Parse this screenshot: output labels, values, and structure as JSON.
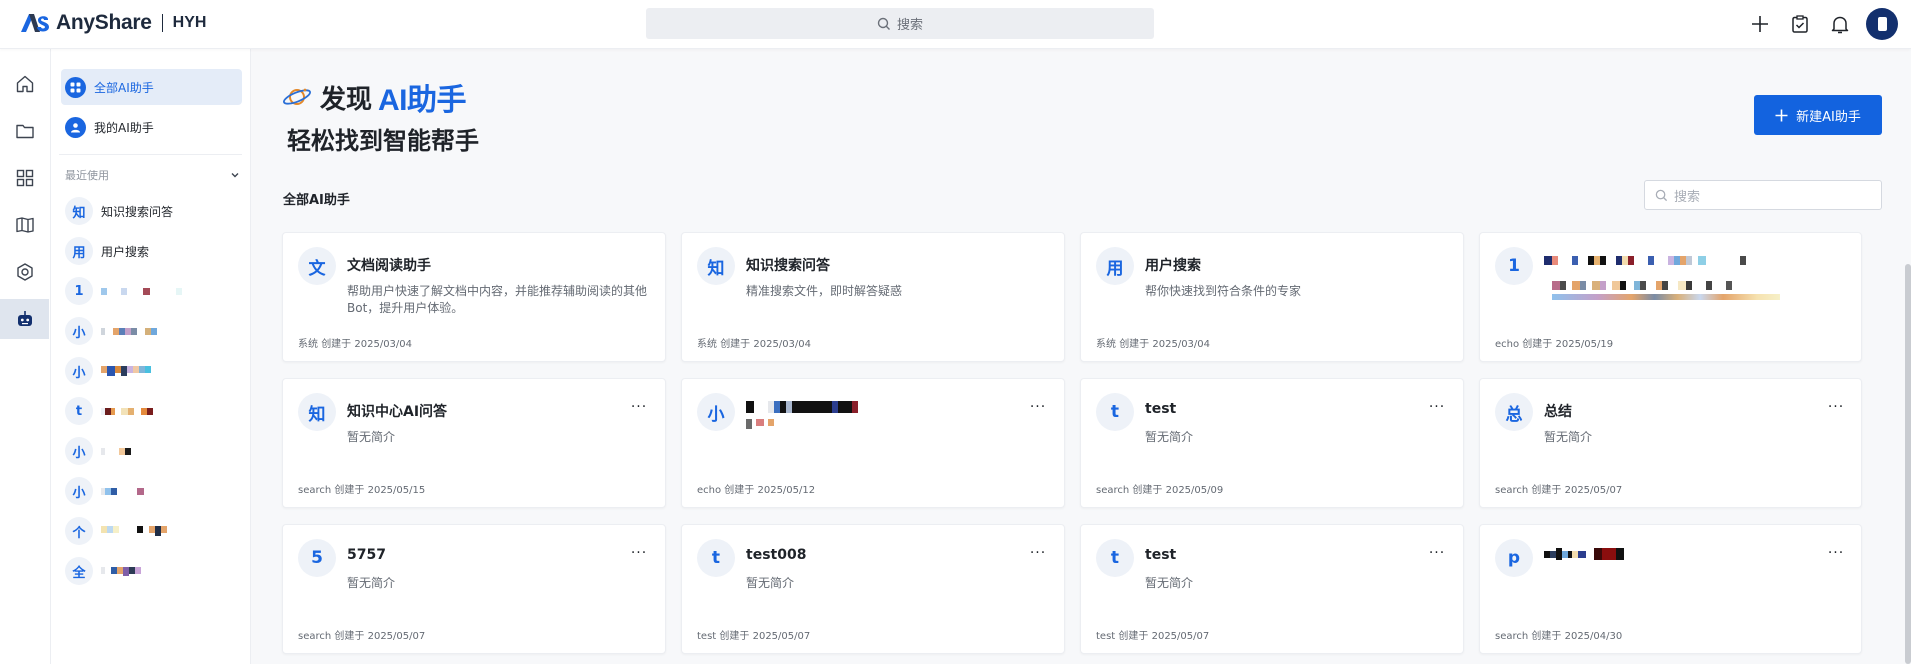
{
  "app": {
    "brand": "AnyShare",
    "org": "HYH",
    "search_placeholder": "搜索",
    "brand_color": "#1a66e0"
  },
  "top_actions": [
    "plus-icon",
    "clipboard-check-icon",
    "bell-icon",
    "avatar"
  ],
  "rail": [
    "home-icon",
    "folder-icon",
    "apps-grid-icon",
    "book-icon",
    "hexagon-icon",
    "robot-icon"
  ],
  "sidebar": {
    "nav": [
      {
        "label": "全部AI助手",
        "active": true,
        "icon": "grid-icon"
      },
      {
        "label": "我的AI助手",
        "active": false,
        "icon": "user-icon"
      }
    ],
    "recent_label": "最近使用",
    "recent": [
      {
        "badge": "知",
        "label": "知识搜索问答"
      },
      {
        "badge": "用",
        "label": "用户搜索"
      },
      {
        "badge": "1",
        "label": ""
      },
      {
        "badge": "小",
        "label": ""
      },
      {
        "badge": "小",
        "label": ""
      },
      {
        "badge": "t",
        "label": ""
      },
      {
        "badge": "小",
        "label": ""
      },
      {
        "badge": "小",
        "label": ""
      },
      {
        "badge": "个",
        "label": ""
      },
      {
        "badge": "全",
        "label": ""
      }
    ]
  },
  "main": {
    "hero_prefix": "发现",
    "hero_highlight": "AI助手",
    "hero_subtitle": "轻松找到智能帮手",
    "new_button": "新建AI助手",
    "section_title": "全部AI助手",
    "search_placeholder": "搜索"
  },
  "cards": [
    {
      "badge": "文",
      "name": "文档阅读助手",
      "desc": "帮助用户快速了解文档中内容，并能推荐辅助阅读的其他Bot，提升用户体验。",
      "creator": "系统",
      "created_label": "创建于",
      "date": "2025/03/04",
      "has_more": false
    },
    {
      "badge": "知",
      "name": "知识搜索问答",
      "desc": "精准搜索文件，即时解答疑惑",
      "creator": "系统",
      "created_label": "创建于",
      "date": "2025/03/04",
      "has_more": false
    },
    {
      "badge": "用",
      "name": "用户搜索",
      "desc": "帮你快速找到符合条件的专家",
      "creator": "系统",
      "created_label": "创建于",
      "date": "2025/03/04",
      "has_more": false
    },
    {
      "badge": "1",
      "name": "",
      "desc": "",
      "creator": "echo",
      "created_label": "创建于",
      "date": "2025/05/19",
      "has_more": false
    },
    {
      "badge": "知",
      "name": "知识中心AI问答",
      "desc": "暂无简介",
      "creator": "search",
      "created_label": "创建于",
      "date": "2025/05/15",
      "has_more": true
    },
    {
      "badge": "小",
      "name": "",
      "desc": "",
      "creator": "echo",
      "created_label": "创建于",
      "date": "2025/05/12",
      "has_more": true
    },
    {
      "badge": "t",
      "name": "test",
      "desc": "暂无简介",
      "creator": "search",
      "created_label": "创建于",
      "date": "2025/05/09",
      "has_more": true
    },
    {
      "badge": "总",
      "name": "总结",
      "desc": "暂无简介",
      "creator": "search",
      "created_label": "创建于",
      "date": "2025/05/07",
      "has_more": true
    },
    {
      "badge": "5",
      "name": "5757",
      "desc": "暂无简介",
      "creator": "search",
      "created_label": "创建于",
      "date": "2025/05/07",
      "has_more": true
    },
    {
      "badge": "t",
      "name": "test008",
      "desc": "暂无简介",
      "creator": "test",
      "created_label": "创建于",
      "date": "2025/05/07",
      "has_more": true
    },
    {
      "badge": "t",
      "name": "test",
      "desc": "暂无简介",
      "creator": "test",
      "created_label": "创建于",
      "date": "2025/05/07",
      "has_more": true
    },
    {
      "badge": "p",
      "name": "",
      "desc": "",
      "creator": "search",
      "created_label": "创建于",
      "date": "2025/04/30",
      "has_more": true
    }
  ]
}
